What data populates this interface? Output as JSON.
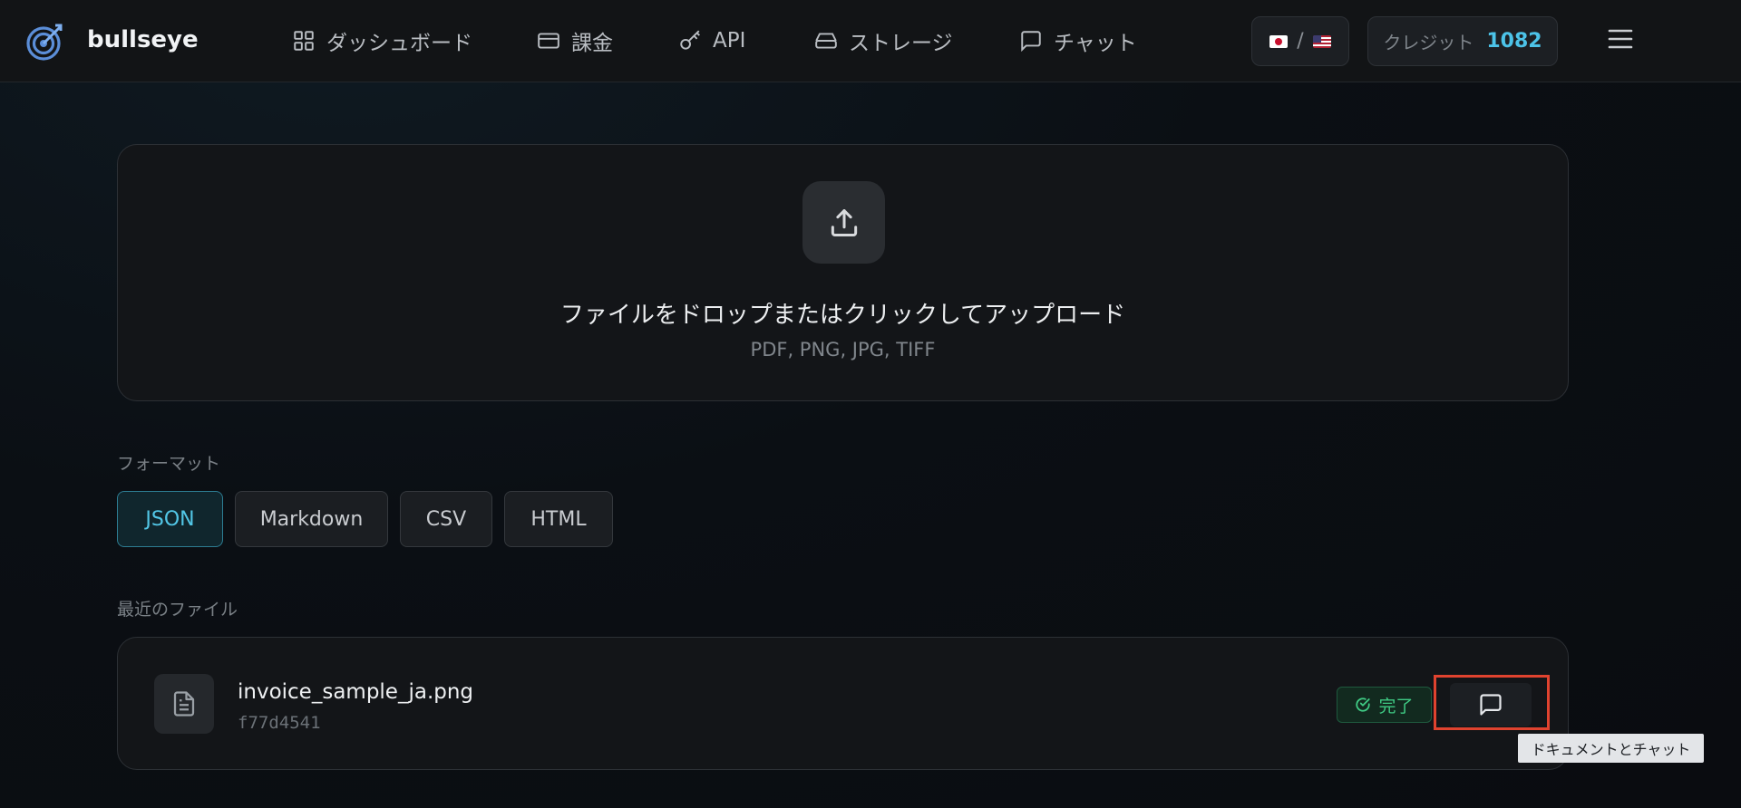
{
  "header": {
    "brand": "bullseye",
    "nav": [
      {
        "label": "ダッシュボード",
        "icon": "grid-icon"
      },
      {
        "label": "課金",
        "icon": "card-icon"
      },
      {
        "label": "API",
        "icon": "key-icon"
      },
      {
        "label": "ストレージ",
        "icon": "drive-icon"
      },
      {
        "label": "チャット",
        "icon": "chat-icon"
      }
    ],
    "lang_separator": "/",
    "credit_label": "クレジット",
    "credit_value": "1082"
  },
  "upload": {
    "title": "ファイルをドロップまたはクリックしてアップロード",
    "formats": "PDF, PNG, JPG, TIFF"
  },
  "format_section": {
    "label": "フォーマット",
    "options": [
      "JSON",
      "Markdown",
      "CSV",
      "HTML"
    ],
    "selected": "JSON"
  },
  "recent": {
    "label": "最近のファイル",
    "files": [
      {
        "name": "invoice_sample_ja.png",
        "id": "f77d4541",
        "status": "完了"
      }
    ]
  },
  "tooltip": "ドキュメントとチャット",
  "colors": {
    "accent": "#4cc3e8",
    "success": "#3fcb84",
    "highlight": "#e0432f"
  }
}
